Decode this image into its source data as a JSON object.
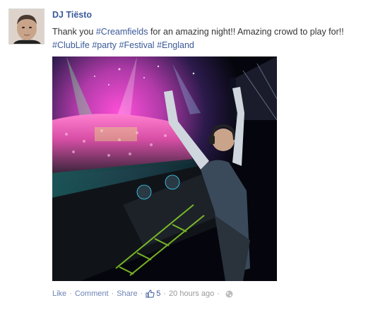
{
  "post": {
    "author": "DJ Tiësto",
    "message": {
      "lead": "Thank you ",
      "tag_creamfields": "#Creamfields",
      "mid": " for an amazing night!! Amazing crowd to play for!! ",
      "tag_clublife": "#ClubLife",
      "space1": " ",
      "tag_party": "#party",
      "space2": " ",
      "tag_festival": "#Festival",
      "space3": " ",
      "tag_england": "#England"
    },
    "photo_icon": "concert-photo",
    "footer": {
      "like": "Like",
      "comment": "Comment",
      "share": "Share",
      "like_count": "5",
      "timestamp": "20 hours ago",
      "privacy_icon": "globe-icon",
      "separator": "·"
    }
  },
  "colors": {
    "link_blue": "#3b5998",
    "footer_link": "#6d84b4",
    "muted": "#999999"
  }
}
